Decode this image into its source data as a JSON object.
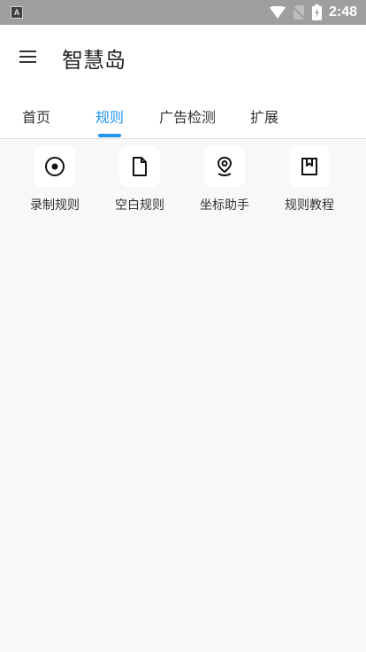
{
  "status_bar": {
    "notification_letter": "A",
    "time": "2:48",
    "icons": [
      "wifi-icon",
      "no-sim-icon",
      "battery-charging-icon"
    ]
  },
  "app_bar": {
    "title": "智慧岛",
    "menu_icon": "hamburger-menu-icon"
  },
  "tabs": [
    {
      "label": "首页",
      "active": false
    },
    {
      "label": "规则",
      "active": true
    },
    {
      "label": "广告检测",
      "active": false
    },
    {
      "label": "扩展",
      "active": false
    }
  ],
  "accent_color": "#2196f3",
  "tiles": [
    {
      "label": "录制规则",
      "icon": "record-icon"
    },
    {
      "label": "空白规则",
      "icon": "blank-file-icon"
    },
    {
      "label": "坐标助手",
      "icon": "location-pin-icon"
    },
    {
      "label": "规则教程",
      "icon": "bookmark-book-icon"
    }
  ]
}
